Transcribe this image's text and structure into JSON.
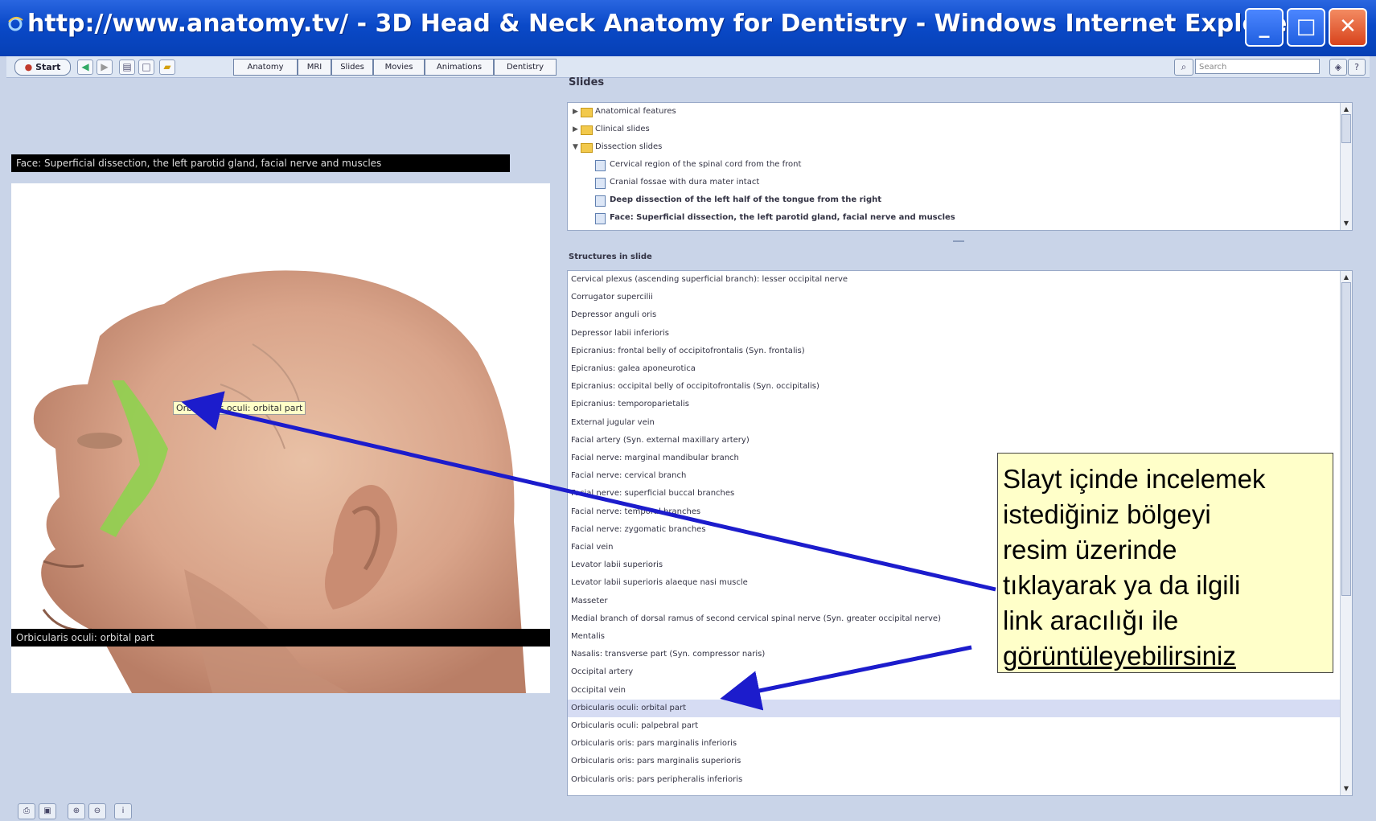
{
  "window": {
    "title": "http://www.anatomy.tv/ - 3D Head & Neck Anatomy for Dentistry - Windows Internet Explorer",
    "controls": {
      "minimize": "_",
      "maximize": "□",
      "close": "✕"
    }
  },
  "toolbar": {
    "start_label": "Start",
    "tabs": [
      "Anatomy",
      "MRI",
      "Slides",
      "Movies",
      "Animations",
      "Dentistry"
    ],
    "search_placeholder": "Search"
  },
  "image_panel": {
    "caption_top": "Face: Superficial dissection, the left parotid gland, facial nerve and muscles",
    "caption_bottom": "Orbicularis oculi: orbital part",
    "hover_label": "Orbicularis oculi: orbital part"
  },
  "slides_panel": {
    "title": "Slides",
    "folders": [
      {
        "label": "Anatomical features",
        "expanded": false
      },
      {
        "label": "Clinical slides",
        "expanded": false
      },
      {
        "label": "Dissection slides",
        "expanded": true
      }
    ],
    "items": [
      "Cervical region of the spinal cord from the front",
      "Cranial fossae with dura mater intact",
      "Deep dissection of the left half of the tongue from the right",
      "Face: Superficial dissection, the left parotid gland, facial nerve and muscles"
    ]
  },
  "structures_panel": {
    "title": "Structures in slide",
    "selected_index": 24,
    "items": [
      "Cervical plexus (ascending superficial branch): lesser occipital nerve",
      "Corrugator supercilii",
      "Depressor anguli oris",
      "Depressor labii inferioris",
      "Epicranius: frontal belly of occipitofrontalis (Syn. frontalis)",
      "Epicranius: galea aponeurotica",
      "Epicranius: occipital belly of occipitofrontalis (Syn. occipitalis)",
      "Epicranius: temporoparietalis",
      "External jugular vein",
      "Facial artery (Syn. external maxillary artery)",
      "Facial nerve: marginal mandibular branch",
      "Facial nerve: cervical branch",
      "Facial nerve: superficial buccal branches",
      "Facial nerve: temporal branches",
      "Facial nerve: zygomatic branches",
      "Facial vein",
      "Levator labii superioris",
      "Levator labii superioris alaeque nasi muscle",
      "Masseter",
      "Medial branch of dorsal ramus of second cervical spinal nerve (Syn. greater occipital nerve)",
      "Mentalis",
      "Nasalis: transverse part (Syn. compressor naris)",
      "Occipital artery",
      "Occipital vein",
      "Orbicularis oculi: orbital part",
      "Orbicularis oculi: palpebral part",
      "Orbicularis oris: pars marginalis inferioris",
      "Orbicularis oris: pars marginalis superioris",
      "Orbicularis oris: pars peripheralis inferioris"
    ]
  },
  "callout": {
    "lines": [
      "Slayt içinde incelemek",
      "istediğiniz bölgeyi",
      "resim üzerinde",
      "tıklayarak ya da ilgili",
      "link aracılığı ile",
      "görüntüleyebilirsiniz"
    ]
  },
  "colors": {
    "titlebar": "#0a49c8",
    "arrow": "#1c1ccc",
    "highlight": "#8fd14f",
    "selected_row": "#d6dcf3"
  }
}
